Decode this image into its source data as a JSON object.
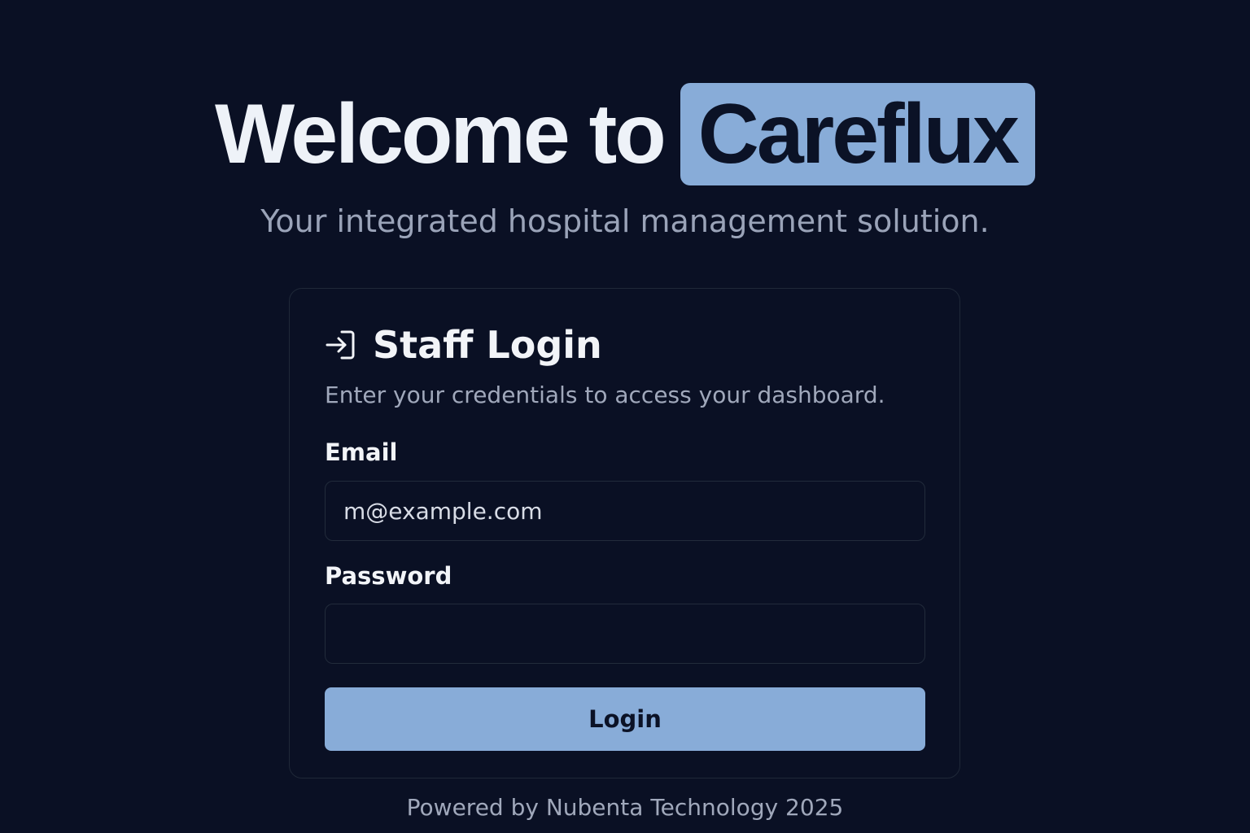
{
  "hero": {
    "title_prefix": "Welcome to",
    "brand": "Careflux",
    "subtitle": "Your integrated hospital management solution."
  },
  "login_card": {
    "icon": "login-arrow-icon",
    "title": "Staff Login",
    "description": "Enter your credentials to access your dashboard.",
    "email_label": "Email",
    "email_placeholder": "m@example.com",
    "email_value": "",
    "password_label": "Password",
    "password_placeholder": "",
    "password_value": "",
    "button_label": "Login"
  },
  "footer": {
    "text": "Powered by Nubenta Technology 2025"
  },
  "colors": {
    "background": "#0a1024",
    "accent": "#88acd8",
    "text_primary": "#f2f4f8",
    "text_muted": "#a0a8bb"
  }
}
